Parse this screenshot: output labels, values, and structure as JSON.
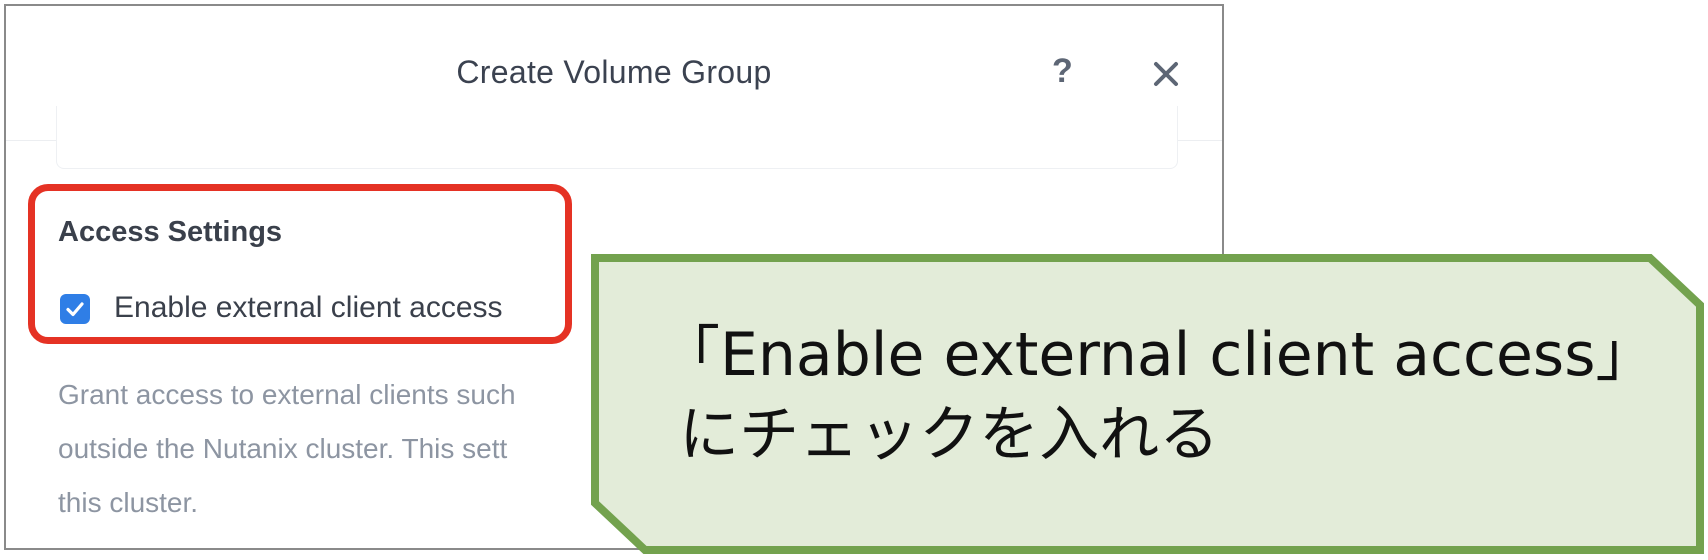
{
  "dialog": {
    "title": "Create Volume Group",
    "help_label": "?",
    "close_icon": "close-icon"
  },
  "access_settings": {
    "title": "Access Settings",
    "checkbox_label": "Enable external client access",
    "checkbox_checked": true,
    "help_lines": [
      "Grant access to external clients such",
      "outside the Nutanix cluster. This sett",
      "this cluster."
    ]
  },
  "annotation": {
    "line1": "「Enable external client access」",
    "line2": " にチェックを入れる",
    "highlight_color": "#e53224",
    "callout_fill": "#e3ecd9",
    "callout_border": "#73a24e"
  }
}
